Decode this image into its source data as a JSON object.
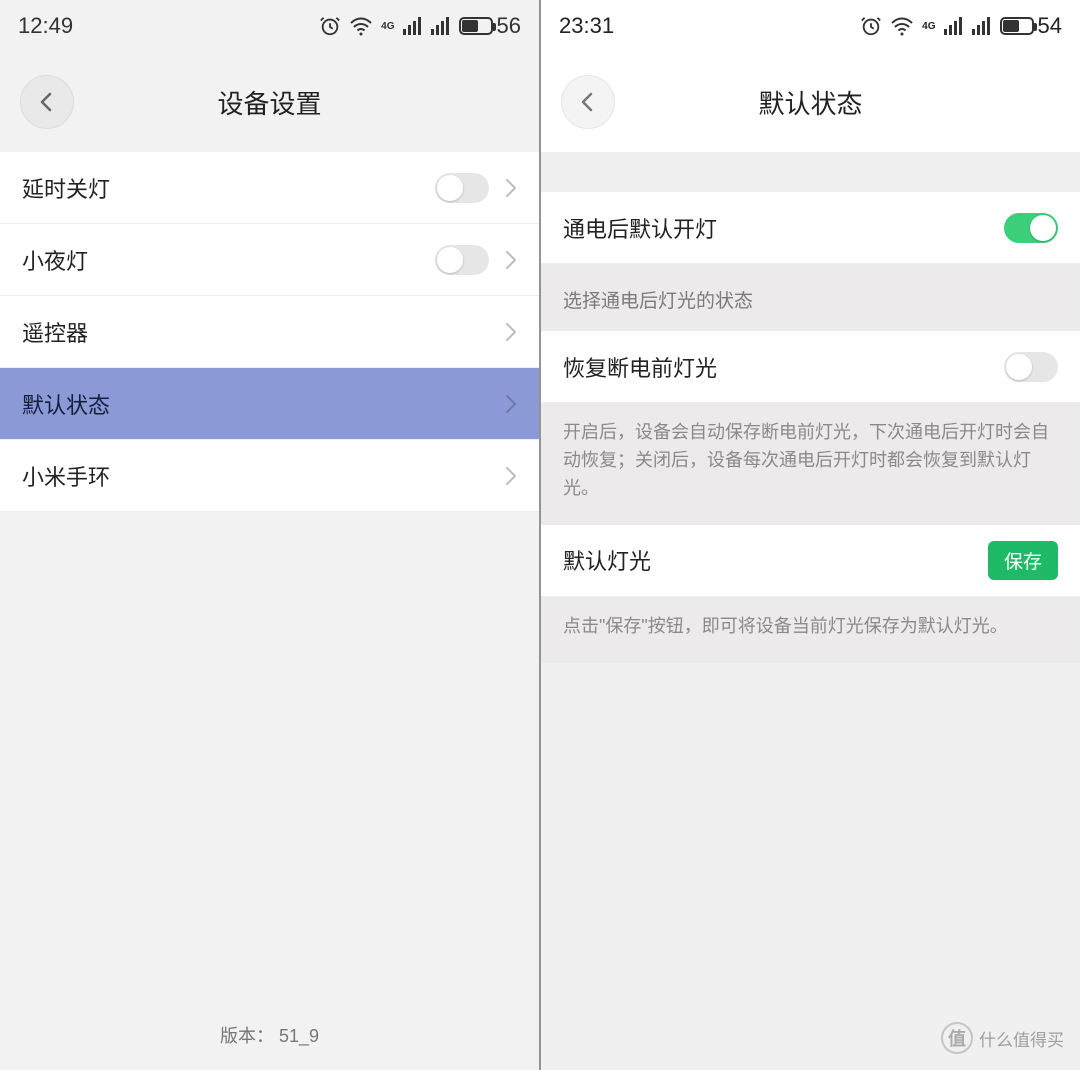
{
  "left": {
    "statusbar": {
      "time": "12:49",
      "battery_text": "56",
      "battery_pct": 56
    },
    "title": "设备设置",
    "rows": [
      {
        "label": "延时关灯",
        "has_toggle": true,
        "toggle_on": false,
        "has_chevron": true,
        "pressed": false
      },
      {
        "label": "小夜灯",
        "has_toggle": true,
        "toggle_on": false,
        "has_chevron": true,
        "pressed": false
      },
      {
        "label": "遥控器",
        "has_toggle": false,
        "has_chevron": true,
        "pressed": false
      },
      {
        "label": "默认状态",
        "has_toggle": false,
        "has_chevron": true,
        "pressed": true
      },
      {
        "label": "小米手环",
        "has_toggle": false,
        "has_chevron": true,
        "pressed": false
      }
    ],
    "version_label": "版本： 51_9"
  },
  "right": {
    "statusbar": {
      "time": "23:31",
      "battery_text": "54",
      "battery_pct": 54
    },
    "title": "默认状态",
    "row_power_on": {
      "label": "通电后默认开灯",
      "toggle_on": true
    },
    "section_header": "选择通电后灯光的状态",
    "row_restore": {
      "label": "恢复断电前灯光",
      "toggle_on": false
    },
    "explain_restore": "开启后，设备会自动保存断电前灯光，下次通电后开灯时会自动恢复；关闭后，设备每次通电后开灯时都会恢复到默认灯光。",
    "row_default_light": {
      "label": "默认灯光",
      "save_button": "保存"
    },
    "explain_default": "点击\"保存\"按钮，即可将设备当前灯光保存为默认灯光。"
  },
  "watermark": "什么值得买"
}
